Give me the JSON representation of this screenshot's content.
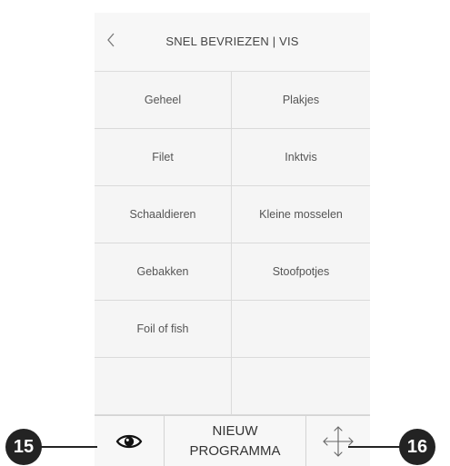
{
  "header": {
    "title": "SNEL BEVRIEZEN | VIS"
  },
  "grid": {
    "rows": [
      [
        "Geheel",
        "Plakjes"
      ],
      [
        "Filet",
        "Inktvis"
      ],
      [
        "Schaaldieren",
        "Kleine mosselen"
      ],
      [
        "Gebakken",
        "Stoofpotjes"
      ],
      [
        "Foil of fish",
        ""
      ],
      [
        "",
        ""
      ]
    ]
  },
  "bottom_bar": {
    "eye_icon": "eye-icon",
    "new_program_line1": "NIEUW",
    "new_program_line2": "PROGRAMMA",
    "move_icon": "move-arrows-icon"
  },
  "callouts": {
    "left": "15",
    "right": "16"
  },
  "colors": {
    "background": "#f4f4f4",
    "divider": "#dadada",
    "callout": "#232323"
  }
}
